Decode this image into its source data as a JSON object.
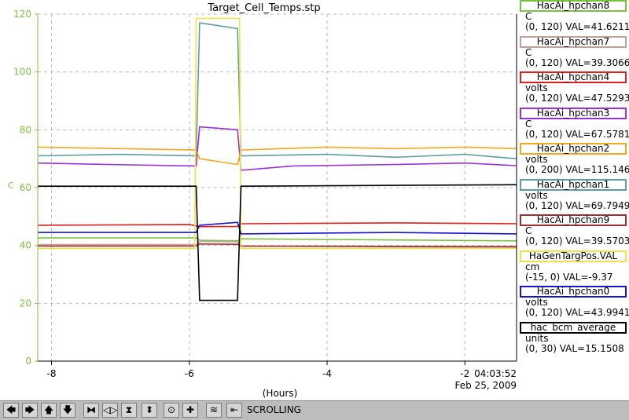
{
  "chart_data": {
    "type": "line",
    "title": "Target_Cell_Temps.stp",
    "xlabel": "(Hours)",
    "ylabel": "C",
    "xlim": [
      -8.2,
      -1.25
    ],
    "ylim": [
      0,
      120
    ],
    "x_ticks": [
      "-8",
      "-6",
      "-4",
      "-2"
    ],
    "y_ticks": [
      "0",
      "20",
      "40",
      "60",
      "80",
      "100",
      "120"
    ],
    "timestamp": [
      "04:03:52",
      "Feb 25, 2009"
    ],
    "series": [
      {
        "name": "HacAi_hpchan8",
        "color": "#7ac142",
        "points": [
          [
            -8.2,
            42.6
          ],
          [
            -5.9,
            42.6
          ],
          [
            -5.85,
            41.8
          ],
          [
            -5.3,
            41.6
          ],
          [
            -5.25,
            42.3
          ],
          [
            -1.25,
            41.6
          ]
        ]
      },
      {
        "name": "HacAi_hpchan7",
        "color": "#c4a09a",
        "points": [
          [
            -8.2,
            40.3
          ],
          [
            -5.9,
            40.3
          ],
          [
            -5.85,
            41.4
          ],
          [
            -5.3,
            41.3
          ],
          [
            -5.25,
            39.8
          ],
          [
            -1.25,
            39.3
          ]
        ]
      },
      {
        "name": "HacAi_hpchan4",
        "color": "#e02020",
        "points": [
          [
            -8.2,
            47.0
          ],
          [
            -6.0,
            47.2
          ],
          [
            -5.85,
            46.5
          ],
          [
            -5.3,
            46.6
          ],
          [
            -5.25,
            47.5
          ],
          [
            -3.0,
            47.8
          ],
          [
            -1.25,
            47.5
          ]
        ]
      },
      {
        "name": "HacAi_hpchan3",
        "color": "#9b30d9",
        "points": [
          [
            -8.2,
            68.5
          ],
          [
            -7.2,
            68.0
          ],
          [
            -5.9,
            67.5
          ],
          [
            -5.85,
            81.0
          ],
          [
            -5.3,
            80.0
          ],
          [
            -5.25,
            66.0
          ],
          [
            -4.5,
            67.5
          ],
          [
            -3.0,
            68.0
          ],
          [
            -2.0,
            68.5
          ],
          [
            -1.25,
            67.6
          ]
        ]
      },
      {
        "name": "HacAi_hpchan2",
        "color": "#f5a623",
        "points": [
          [
            -8.2,
            74.0
          ],
          [
            -7.0,
            73.5
          ],
          [
            -5.9,
            73.0
          ],
          [
            -5.85,
            70.0
          ],
          [
            -5.3,
            68.0
          ],
          [
            -5.25,
            73.0
          ],
          [
            -4.0,
            74.0
          ],
          [
            -3.0,
            73.5
          ],
          [
            -2.0,
            74.0
          ],
          [
            -1.25,
            73.5
          ]
        ]
      },
      {
        "name": "HacAi_hpchan1",
        "color": "#5f9ea0",
        "points": [
          [
            -8.2,
            71.0
          ],
          [
            -7.0,
            71.5
          ],
          [
            -5.9,
            71.0
          ],
          [
            -5.85,
            117.0
          ],
          [
            -5.3,
            115.0
          ],
          [
            -5.25,
            71.0
          ],
          [
            -4.0,
            71.5
          ],
          [
            -3.0,
            70.5
          ],
          [
            -2.0,
            71.5
          ],
          [
            -1.25,
            70.0
          ]
        ]
      },
      {
        "name": "HacAi_hpchan9",
        "color": "#a03030",
        "points": [
          [
            -8.2,
            39.8
          ],
          [
            -5.9,
            39.8
          ],
          [
            -5.85,
            40.5
          ],
          [
            -5.3,
            40.4
          ],
          [
            -5.25,
            39.8
          ],
          [
            -1.25,
            39.6
          ]
        ]
      },
      {
        "name": "HaGenTargPos.VAL",
        "color": "#f2e04a",
        "points": [
          [
            -8.2,
            39.0
          ],
          [
            -5.92,
            39.0
          ],
          [
            -5.9,
            118.5
          ],
          [
            -5.27,
            118.5
          ],
          [
            -5.25,
            39.0
          ],
          [
            -1.25,
            39.0
          ]
        ]
      },
      {
        "name": "HacAi_hpchan0",
        "color": "#1515d0",
        "points": [
          [
            -8.2,
            44.5
          ],
          [
            -5.9,
            44.5
          ],
          [
            -5.85,
            47.0
          ],
          [
            -5.3,
            48.0
          ],
          [
            -5.25,
            44.0
          ],
          [
            -3.0,
            44.5
          ],
          [
            -1.25,
            44.0
          ]
        ]
      },
      {
        "name": "hac_bcm_average",
        "color": "#000000",
        "points": [
          [
            -8.2,
            60.5
          ],
          [
            -5.9,
            60.5
          ],
          [
            -5.85,
            21.0
          ],
          [
            -5.3,
            21.0
          ],
          [
            -5.25,
            60.5
          ],
          [
            -1.25,
            61.0
          ]
        ]
      }
    ]
  },
  "legend": [
    {
      "label": "HacAi_hpchan8",
      "color": "#7ac142",
      "unit": "C",
      "range": "(0, 120) VAL=41.6211"
    },
    {
      "label": "HacAi_hpchan7",
      "color": "#c4a09a",
      "unit": "C",
      "range": "(0, 120) VAL=39.3066"
    },
    {
      "label": "HacAi_hpchan4",
      "color": "#e02020",
      "unit": "volts",
      "range": "(0, 120) VAL=47.5293"
    },
    {
      "label": "HacAi_hpchan3",
      "color": "#9b30d9",
      "unit": "C",
      "range": "(0, 120) VAL=67.5781"
    },
    {
      "label": "HacAi_hpchan2",
      "color": "#f5a623",
      "unit": "volts",
      "range": "(0, 200) VAL=115.146"
    },
    {
      "label": "HacAi_hpchan1",
      "color": "#5f9ea0",
      "unit": "volts",
      "range": "(0, 120) VAL=69.7949"
    },
    {
      "label": "HacAi_hpchan9",
      "color": "#a03030",
      "unit": "C",
      "range": "(0, 120) VAL=39.5703"
    },
    {
      "label": "HaGenTargPos.VAL",
      "color": "#f2e04a",
      "unit": "cm",
      "range": "(-15, 0) VAL=-9.37"
    },
    {
      "label": "HacAi_hpchan0",
      "color": "#1515d0",
      "unit": "volts",
      "range": "(0, 120) VAL=43.9941"
    },
    {
      "label": "hac_bcm_average",
      "color": "#000000",
      "unit": "units",
      "range": "(0, 30) VAL=15.1508"
    }
  ],
  "toolbar": {
    "buttons": [
      {
        "name": "scroll-left-button",
        "icon": "arrow-left-icon",
        "glyph": "🡄"
      },
      {
        "name": "scroll-right-button",
        "icon": "arrow-right-icon",
        "glyph": "🡆"
      },
      {
        "name": "scroll-up-button",
        "icon": "arrow-up-icon",
        "glyph": "🡅"
      },
      {
        "name": "scroll-down-button",
        "icon": "arrow-down-icon",
        "glyph": "🡇"
      },
      {
        "name": "zoom-in-x-button",
        "icon": "zoom-in-x-icon",
        "glyph": "⧓"
      },
      {
        "name": "zoom-out-x-button",
        "icon": "zoom-out-x-icon",
        "glyph": "◁▷"
      },
      {
        "name": "zoom-in-y-button",
        "icon": "zoom-in-y-icon",
        "glyph": "⧗"
      },
      {
        "name": "zoom-out-y-button",
        "icon": "zoom-out-y-icon",
        "glyph": "⬍"
      },
      {
        "name": "config-button",
        "icon": "config-icon",
        "glyph": "⊙"
      },
      {
        "name": "add-button",
        "icon": "plus-icon",
        "glyph": "✚"
      },
      {
        "name": "autoscale-button",
        "icon": "autoscale-icon",
        "glyph": "≋"
      },
      {
        "name": "mode-button",
        "icon": "scroll-mode-icon",
        "glyph": "⇤"
      }
    ],
    "status": "SCROLLING"
  }
}
